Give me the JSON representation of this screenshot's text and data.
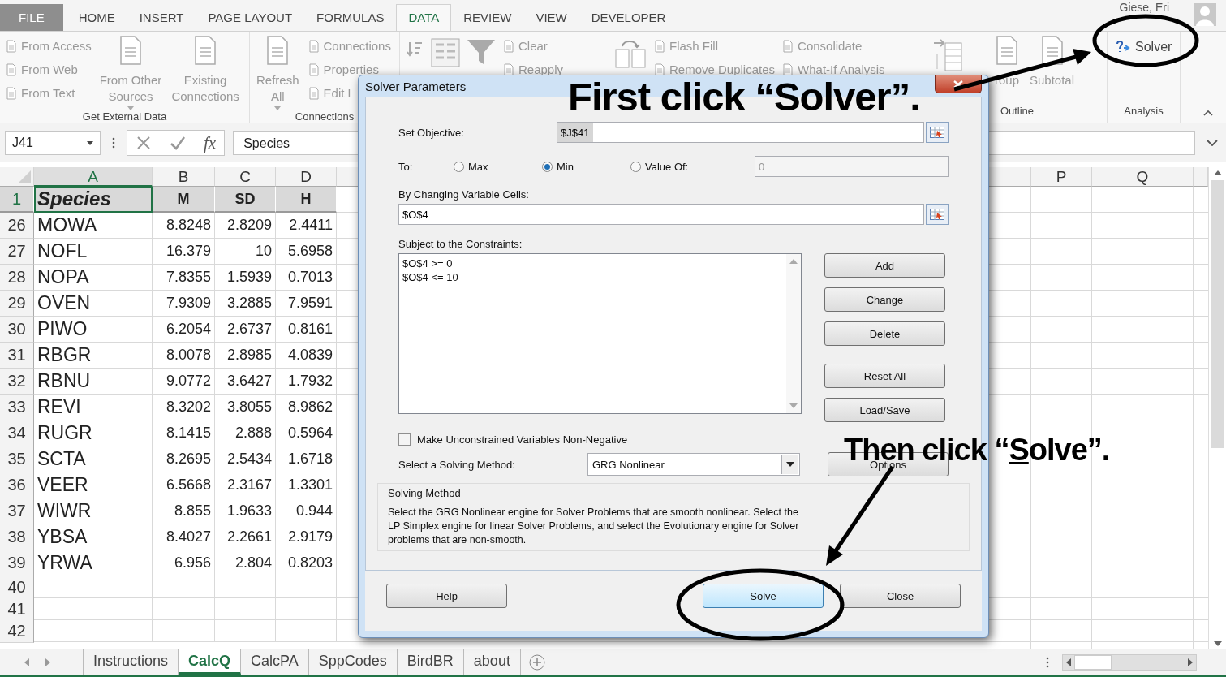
{
  "ribbon_tabs": [
    {
      "label": "FILE",
      "kind": "file",
      "selected": false
    },
    {
      "label": "HOME",
      "kind": "tab",
      "selected": false
    },
    {
      "label": "INSERT",
      "kind": "tab",
      "selected": false
    },
    {
      "label": "PAGE LAYOUT",
      "kind": "tab",
      "selected": false
    },
    {
      "label": "FORMULAS",
      "kind": "tab",
      "selected": false
    },
    {
      "label": "DATA",
      "kind": "tab",
      "selected": true
    },
    {
      "label": "REVIEW",
      "kind": "tab",
      "selected": false
    },
    {
      "label": "VIEW",
      "kind": "tab",
      "selected": false
    },
    {
      "label": "DEVELOPER",
      "kind": "tab",
      "selected": false
    }
  ],
  "account": {
    "name": "Giese, Eri"
  },
  "ribbon_groups": [
    {
      "label": "Get External Data",
      "items": [
        {
          "kind": "stack",
          "items": [
            {
              "label": "From Access"
            },
            {
              "label": "From Web"
            },
            {
              "label": "From Text"
            }
          ]
        },
        {
          "kind": "large",
          "lines": [
            "From Other",
            "Sources"
          ],
          "menu": true
        },
        {
          "kind": "large",
          "lines": [
            "Existing",
            "Connections"
          ],
          "menu": false
        }
      ]
    },
    {
      "label": "Connections",
      "items": [
        {
          "kind": "large",
          "lines": [
            "Refresh",
            "All"
          ],
          "menu": true
        },
        {
          "kind": "stack",
          "items": [
            {
              "label": "Connections"
            },
            {
              "label": "Properties"
            },
            {
              "label": "Edit L"
            }
          ]
        }
      ]
    },
    {
      "items": [
        {
          "kind": "sort"
        },
        {
          "kind": "filter"
        },
        {
          "kind": "stack",
          "items": [
            {
              "label": "Clear"
            },
            {
              "label": "Reapply"
            }
          ]
        }
      ]
    },
    {
      "items": [
        {
          "kind": "columns"
        },
        {
          "kind": "stack",
          "items": [
            {
              "label": "Flash Fill"
            },
            {
              "label": "Remove Duplicates"
            }
          ]
        },
        {
          "kind": "stack",
          "items": [
            {
              "label": "Consolidate"
            },
            {
              "label": "What-If Analysis"
            }
          ]
        }
      ]
    },
    {
      "label": "Outline",
      "items": [
        {
          "kind": "outline"
        },
        {
          "kind": "large",
          "lines": [
            "roup"
          ],
          "menu": false
        },
        {
          "kind": "large",
          "lines": [
            "Subtotal"
          ],
          "menu": false
        }
      ]
    },
    {
      "label": "Analysis",
      "items": [
        {
          "kind": "solver",
          "label": "Solver"
        }
      ]
    }
  ],
  "formula_bar": {
    "name_box": "J41",
    "function_label": "fx",
    "value": "Species"
  },
  "columns": [
    "A",
    "B",
    "C",
    "D",
    "P",
    "Q"
  ],
  "header_row": {
    "number": "1",
    "cells": [
      "Species",
      "M",
      "SD",
      "H"
    ]
  },
  "rows": [
    {
      "number": "26",
      "species": "MOWA",
      "m": "8.8248",
      "sd": "2.8209",
      "h": "2.4411"
    },
    {
      "number": "27",
      "species": "NOFL",
      "m": "16.379",
      "sd": "10",
      "h": "5.6958"
    },
    {
      "number": "28",
      "species": "NOPA",
      "m": "7.8355",
      "sd": "1.5939",
      "h": "0.7013"
    },
    {
      "number": "29",
      "species": "OVEN",
      "m": "7.9309",
      "sd": "3.2885",
      "h": "7.9591"
    },
    {
      "number": "30",
      "species": "PIWO",
      "m": "6.2054",
      "sd": "2.6737",
      "h": "0.8161"
    },
    {
      "number": "31",
      "species": "RBGR",
      "m": "8.0078",
      "sd": "2.8985",
      "h": "4.0839"
    },
    {
      "number": "32",
      "species": "RBNU",
      "m": "9.0772",
      "sd": "3.6427",
      "h": "1.7932"
    },
    {
      "number": "33",
      "species": "REVI",
      "m": "8.3202",
      "sd": "3.8055",
      "h": "8.9862"
    },
    {
      "number": "34",
      "species": "RUGR",
      "m": "8.1415",
      "sd": "2.888",
      "h": "0.5964"
    },
    {
      "number": "35",
      "species": "SCTA",
      "m": "8.2695",
      "sd": "2.5434",
      "h": "1.6718"
    },
    {
      "number": "36",
      "species": "VEER",
      "m": "6.5668",
      "sd": "2.3167",
      "h": "1.3301"
    },
    {
      "number": "37",
      "species": "WIWR",
      "m": "8.855",
      "sd": "1.9633",
      "h": "0.944"
    },
    {
      "number": "38",
      "species": "YBSA",
      "m": "8.4027",
      "sd": "2.2661",
      "h": "2.9179"
    },
    {
      "number": "39",
      "species": "YRWA",
      "m": "6.956",
      "sd": "2.804",
      "h": "0.8203"
    }
  ],
  "empty_rows": [
    "40",
    "41",
    "42"
  ],
  "sheet_tabs": [
    {
      "label": "Instructions",
      "selected": false
    },
    {
      "label": "CalcQ",
      "selected": true
    },
    {
      "label": "CalcPA",
      "selected": false
    },
    {
      "label": "SppCodes",
      "selected": false
    },
    {
      "label": "BirdBR",
      "selected": false
    },
    {
      "label": "about",
      "selected": false
    }
  ],
  "dialog": {
    "title": "Solver Parameters",
    "objective": {
      "label": "Set Objective:",
      "value": "$J$41"
    },
    "to": {
      "label": "To:",
      "options": [
        {
          "label": "Max",
          "selected": false
        },
        {
          "label": "Min",
          "selected": true
        },
        {
          "label": "Value Of:",
          "selected": false
        }
      ],
      "value_field": "0"
    },
    "changing": {
      "label": "By Changing Variable Cells:",
      "value": "$O$4"
    },
    "constraints": {
      "label": "Subject to the Constraints:",
      "items": [
        "$O$4 >= 0",
        "$O$4 <= 10"
      ]
    },
    "side_buttons": [
      "Add",
      "Change",
      "Delete",
      "Reset All",
      "Load/Save"
    ],
    "nonnegative": {
      "label": "Make Unconstrained Variables Non-Negative",
      "checked": false
    },
    "method": {
      "label": "Select a Solving Method:",
      "value": "GRG Nonlinear"
    },
    "options_button": "Options",
    "info": {
      "title": "Solving Method",
      "text": "Select the GRG Nonlinear engine for Solver Problems that are smooth nonlinear. Select the LP Simplex engine for linear Solver Problems, and select the Evolutionary engine for Solver problems that are non-smooth."
    },
    "buttons": [
      {
        "label": "Help",
        "default": false
      },
      {
        "label": "Solve",
        "default": true
      },
      {
        "label": "Close",
        "default": false
      }
    ]
  },
  "annotations": {
    "first": "First click “Solver”.",
    "then": {
      "before": "Then click “",
      "underlined": "S",
      "after": "olve”."
    }
  }
}
